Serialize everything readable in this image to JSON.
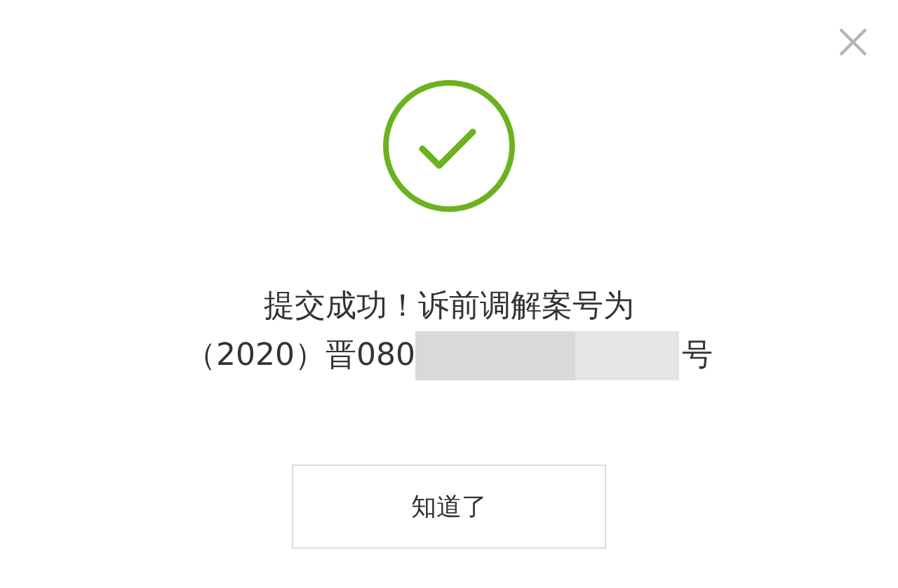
{
  "dialog": {
    "success": true,
    "message_line_1": "提交成功！诉前调解案号为",
    "message_line_2_start": "（2020）晋080",
    "message_line_2_end": "号",
    "button": "知道了"
  }
}
